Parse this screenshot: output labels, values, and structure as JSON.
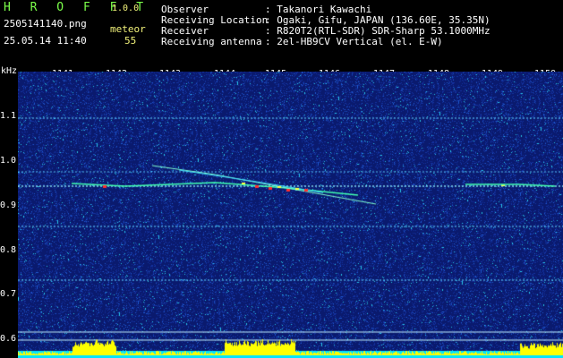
{
  "header": {
    "brand": "H R O F F T",
    "version": "1.0.0",
    "filename": "2505141140.png",
    "datetime": "25.05.14 11:40",
    "meteor_label": "meteor",
    "meteor_count": "55"
  },
  "info": {
    "observer_label": "Observer",
    "observer_value": ": Takanori Kawachi",
    "location_label": "Receiving Location",
    "location_value": ": Ogaki, Gifu, JAPAN (136.60E, 35.35N)",
    "receiver_label": "Receiver",
    "receiver_value": ": R820T2(RTL-SDR) SDR-Sharp 53.1000MHz",
    "antenna_label": "Receiving antenna",
    "antenna_value": ": 2el-HB9CV Vertical (el. E-W)"
  },
  "axis": {
    "unit": "kHz",
    "y_ticks": [
      "1.1",
      "1.0",
      "0.9",
      "0.8",
      "0.7",
      "0.6"
    ],
    "x_ticks": [
      "1141",
      "1142",
      "1143",
      "1144",
      "1145",
      "1146",
      "1147",
      "1148",
      "1149",
      "1150"
    ]
  },
  "colors": {
    "background": "#000000",
    "spectrogram_base": "#0a1a6e",
    "label_green": "#7CFF4A",
    "label_yellow": "#F2F27A",
    "power_bar": "#FFFF00",
    "power_base": "#00E5FF"
  }
}
